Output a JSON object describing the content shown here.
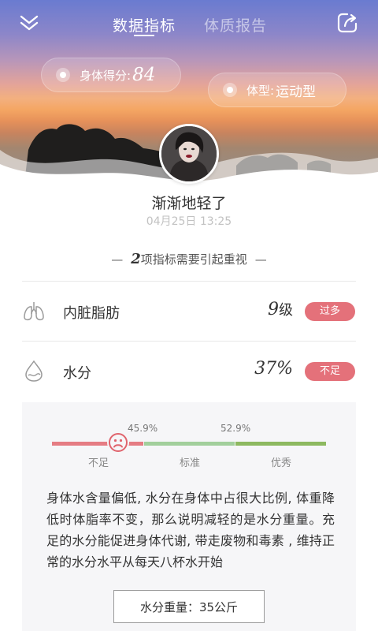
{
  "header": {
    "tabs": [
      {
        "label": "数据指标",
        "active": true
      },
      {
        "label": "体质报告",
        "active": false
      }
    ],
    "score": {
      "label": "身体得分:",
      "value": "84"
    },
    "body_type": {
      "label": "体型:",
      "value": "运动型"
    }
  },
  "profile": {
    "name": "渐渐地轻了",
    "timestamp": "04月25日 13:25"
  },
  "summary": {
    "count": "2",
    "text": "项指标需要引起重视"
  },
  "metrics": [
    {
      "name": "内脏脂肪",
      "value": "9",
      "unit": "级",
      "status": "过多",
      "icon": "lungs-icon"
    },
    {
      "name": "水分",
      "value": "37%",
      "unit": "",
      "status": "不足",
      "icon": "water-drop-icon"
    }
  ],
  "detail": {
    "thresholds": [
      "45.9%",
      "52.9%"
    ],
    "levels": [
      "不足",
      "标准",
      "优秀"
    ],
    "level_fraction": 0.24,
    "description": "身体水含量偏低, 水分在身体中占很大比例, 体重降低时体脂率不变，那么说明减轻的是水分重量。充足的水分能促进身体代谢, 带走废物和毒素 , 维持正常的水分水平从每天八杯水开始",
    "weight_button": "水分重量：35公斤"
  },
  "colors": {
    "badge": "#e4717a",
    "low": "#e57c83",
    "standard": "#a2cf9c",
    "excellent": "#8db960"
  }
}
